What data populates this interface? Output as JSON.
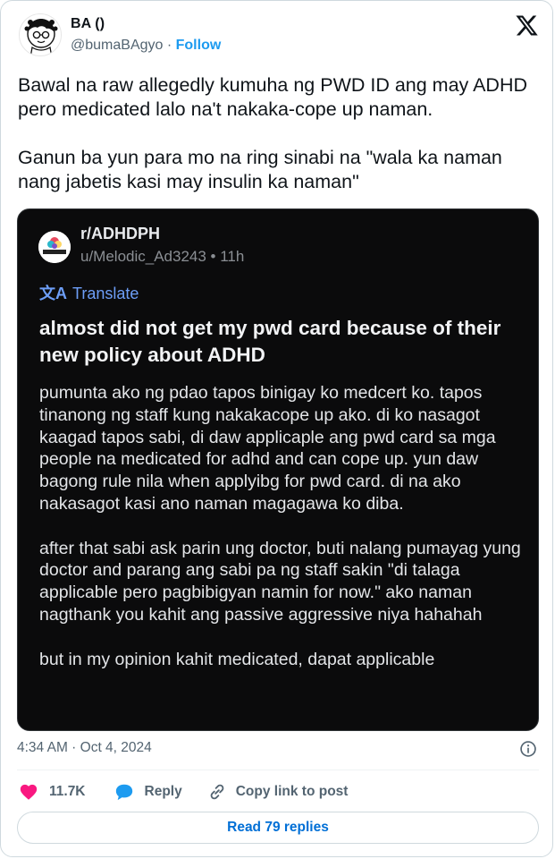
{
  "author": {
    "display_name": "BA (‍)",
    "handle": "@bumaBAgyo",
    "separator": " · ",
    "follow_label": "Follow",
    "avatar_icon": "doodle-face-avatar"
  },
  "platform_icon": "x-logo-icon",
  "tweet": {
    "paragraphs": [
      "Bawal na raw allegedly kumuha ng PWD ID ang may ADHD pero medicated lalo na't nakaka-cope up naman.",
      "Ganun ba yun para mo na ring sinabi na \"wala ka naman nang jabetis kasi may insulin ka naman\""
    ]
  },
  "embedded_post": {
    "subreddit": "r/ADHDPH",
    "meta": "u/Melodic_Ad3243 • 11h",
    "translate_label": "Translate",
    "title": "almost did not get my pwd card because of their new policy about ADHD",
    "body": [
      "pumunta ako ng pdao tapos binigay ko medcert ko. tapos tinanong ng staff kung nakakacope up ako. di ko nasagot kaagad tapos sabi, di daw applicaple ang pwd card sa mga people na medicated for adhd and can cope up. yun daw bagong rule nila when applyibg for pwd card. di na ako nakasagot kasi ano naman magagawa ko diba.",
      "after that sabi ask parin ung doctor, buti nalang pumayag yung doctor and parang ang sabi pa ng staff sakin \"di talaga applicable pero pagbibigyan namin for now.\" ako naman nagthank you kahit ang passive aggressive niya hahahah",
      "but in my opinion kahit medicated, dapat applicable"
    ]
  },
  "timestamp": "4:34 AM · Oct 4, 2024",
  "actions": {
    "like_count": "11.7K",
    "reply_label": "Reply",
    "copy_label": "Copy link to post"
  },
  "read_replies_label": "Read 79 replies",
  "colors": {
    "accent": "#1d9bf0",
    "like": "#f91880",
    "link_button_text": "#006fd6",
    "embed_bg": "#0b0b0c"
  }
}
